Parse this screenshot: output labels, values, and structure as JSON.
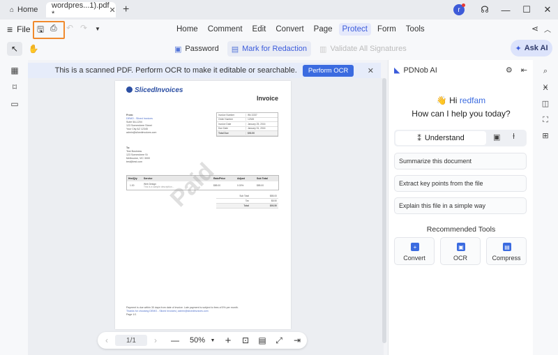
{
  "titlebar": {
    "home_tab": "Home",
    "doc_tab": "wordpres...1).pdf *",
    "close_glyph": "✕",
    "newtab_glyph": "+",
    "avatar_letter": "r"
  },
  "menubar": {
    "file_label": "File",
    "items": [
      "Home",
      "Comment",
      "Edit",
      "Convert",
      "Page",
      "Protect",
      "Form",
      "Tools"
    ],
    "active": "Protect"
  },
  "protect_tools": {
    "password": "Password",
    "redaction": "Mark for Redaction",
    "validate": "Validate All Signatures"
  },
  "ask_ai": "Ask AI",
  "banner": {
    "message": "This is a scanned PDF. Perform OCR to make it editable or searchable.",
    "button": "Perform OCR"
  },
  "document": {
    "logo_text": "SlicedInvoices",
    "title": "Invoice",
    "from_label": "From:",
    "from_lines": [
      "DEMO - Sliced Invoices",
      "Suite 5A-1204",
      "123 Somewhere Street",
      "Your City AZ 12345",
      "admin@slicedinvoices.com"
    ],
    "to_label": "To:",
    "to_lines": [
      "Test Business",
      "123 Somewhere St",
      "Melbourne, VIC 3000",
      "test@test.com"
    ],
    "meta": [
      {
        "k": "Invoice Number",
        "v": "INV-3337"
      },
      {
        "k": "Order Number",
        "v": "12345"
      },
      {
        "k": "Invoice Date",
        "v": "January 25, 2016"
      },
      {
        "k": "Due Date",
        "v": "January 31, 2016"
      },
      {
        "k": "Total Due",
        "v": "$93.50"
      }
    ],
    "table_headers": [
      "Hrs/Qty",
      "Service",
      "Rate/Price",
      "Adjust",
      "Sub Total"
    ],
    "table_row": [
      "1.00",
      "Web Design",
      "$85.00",
      "0.00%",
      "$85.00"
    ],
    "table_row_note": "This is a sample description...",
    "totals": [
      {
        "k": "Sub Total",
        "v": "$85.00"
      },
      {
        "k": "Tax",
        "v": "$8.50"
      },
      {
        "k": "Total",
        "v": "$93.50"
      }
    ],
    "footer_lines": [
      "Payment is due within 30 days from date of invoice. Late payment is subject to fees of 5% per month.",
      "Thanks for choosing DEMO - Sliced Invoices | admin@slicedinvoices.com",
      "Page 1/1"
    ],
    "watermark": "Paid"
  },
  "bottombar": {
    "page_indicator": "1/1",
    "zoom": "50%"
  },
  "ai_panel": {
    "title": "PDNob AI",
    "greeting_prefix": "Hi",
    "username": "redfam",
    "question": "How can I help you today?",
    "mode": "Understand",
    "suggestions": [
      "Summarize this document",
      "Extract key points from the file",
      "Explain this file in a simple way"
    ],
    "recommended_title": "Recommended Tools",
    "tools": [
      "Convert",
      "OCR",
      "Compress"
    ]
  },
  "colors": {
    "accent": "#3b5bdb",
    "highlight_box": "#f08a2d",
    "banner_bg": "#e6ecfa"
  }
}
